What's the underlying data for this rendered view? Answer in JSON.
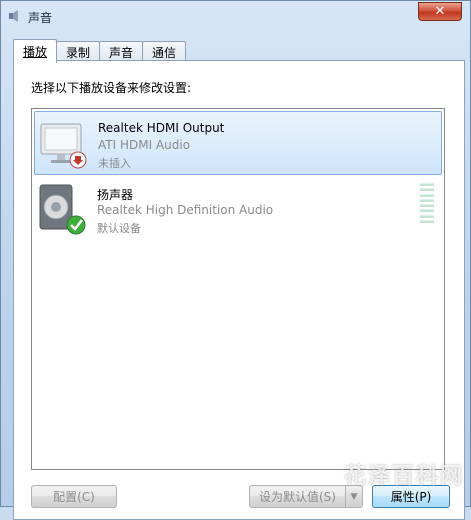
{
  "window": {
    "title": "声音",
    "close_label": "✕",
    "icon": "speaker-icon"
  },
  "tabs": [
    {
      "label": "播放"
    },
    {
      "label": "录制"
    },
    {
      "label": "声音"
    },
    {
      "label": "通信"
    }
  ],
  "instruction": "选择以下播放设备来修改设置:",
  "devices": [
    {
      "name": "Realtek HDMI Output",
      "driver": "ATI HDMI Audio",
      "status": "未插入",
      "icon": "monitor-icon",
      "badge": "unplugged-down-arrow-icon",
      "selected": true
    },
    {
      "name": "扬声器",
      "driver": "Realtek High Definition Audio",
      "status": "默认设备",
      "icon": "speaker-icon",
      "badge": "default-check-icon",
      "selected": false
    }
  ],
  "buttons": {
    "configure": "配置(C)",
    "set_default": "设为默认值(S)",
    "properties": "属性(P)"
  },
  "watermark": "花泽百科网",
  "colors": {
    "selection_bg": "#cfe5fb",
    "level_meter": "#c3e6d2",
    "close_button": "#c0371f"
  }
}
